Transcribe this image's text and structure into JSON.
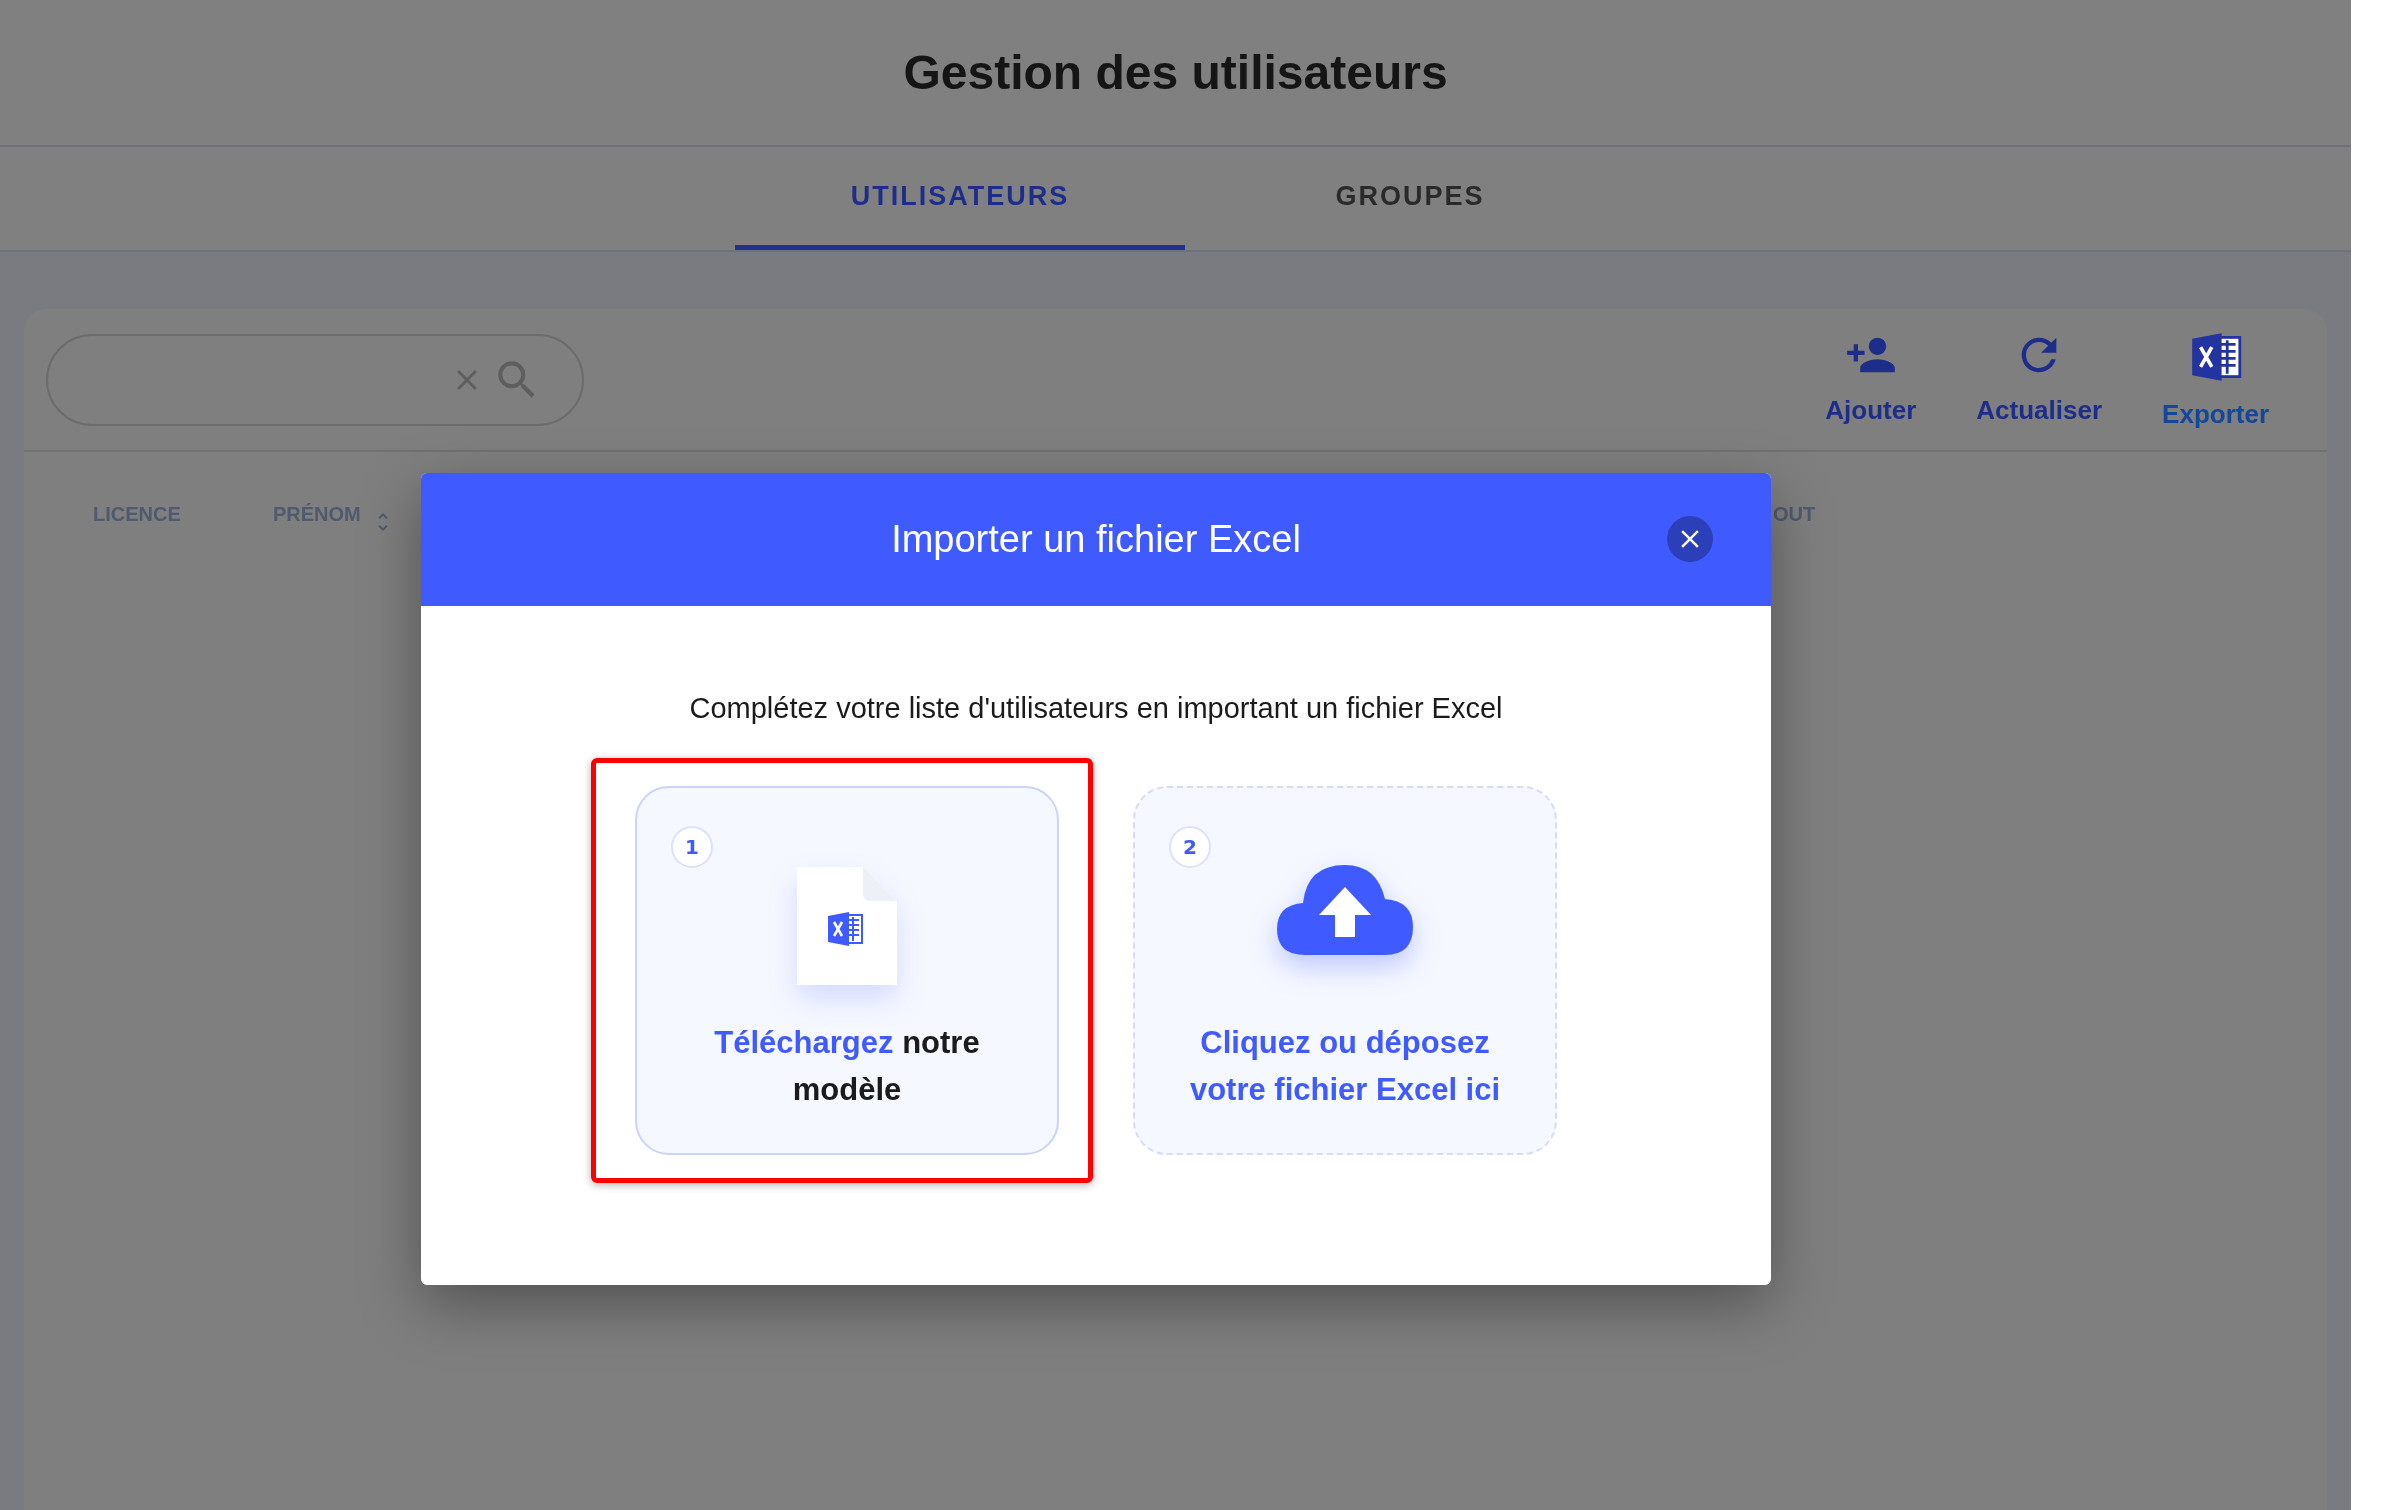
{
  "header": {
    "title": "Gestion des utilisateurs"
  },
  "tabs": [
    {
      "label": "UTILISATEURS",
      "selected": true
    },
    {
      "label": "GROUPES",
      "selected": false
    }
  ],
  "toolbar": {
    "actions": [
      {
        "kind": "add-user",
        "label": "Ajouter"
      },
      {
        "kind": "refresh",
        "label": "Actualiser"
      },
      {
        "kind": "export",
        "label": "Exporter"
      }
    ]
  },
  "table": {
    "columns": [
      {
        "label": "LICENCE",
        "kind": "plain"
      },
      {
        "label": "PRÉNOM",
        "kind": "sortable"
      },
      {
        "label": "OUT",
        "kind": "plain"
      }
    ]
  },
  "modal": {
    "title": "Importer un fichier Excel",
    "intro": "Complétez votre liste d'utilisateurs en important un fichier Excel",
    "steps": [
      {
        "number": "1",
        "kind": "download",
        "link": "Téléchargez",
        "text": "notre modèle",
        "highlighted": true
      },
      {
        "number": "2",
        "kind": "upload",
        "link": "Cliquez ou déposez votre fichier Excel ici",
        "highlighted": false
      }
    ]
  }
}
